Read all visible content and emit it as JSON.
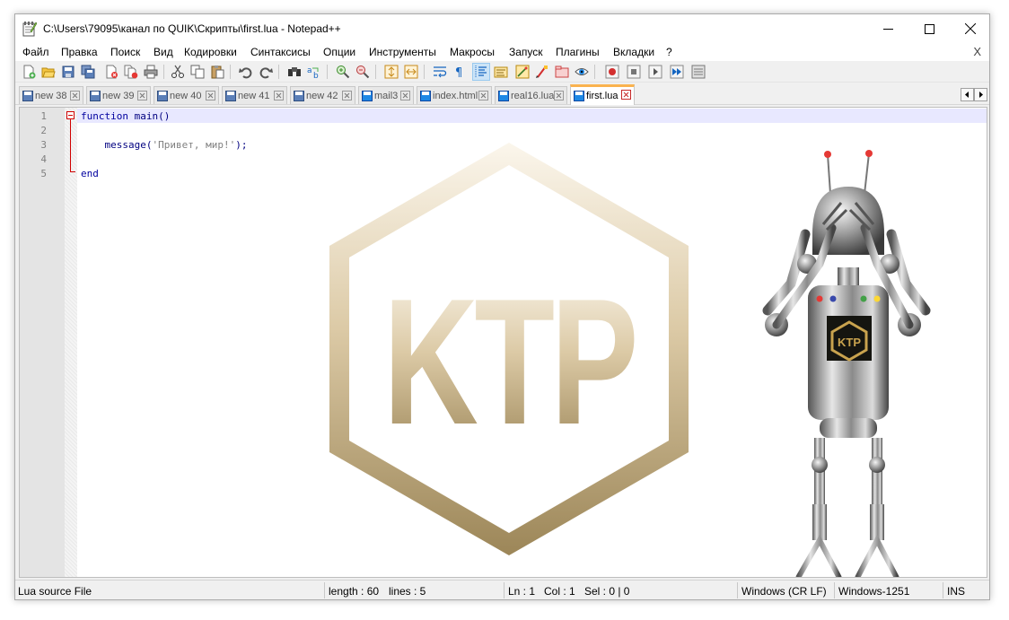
{
  "window": {
    "title": "C:\\Users\\79095\\канал по QUIK\\Скрипты\\first.lua - Notepad++"
  },
  "menu": {
    "items": [
      "Файл",
      "Правка",
      "Поиск",
      "Вид",
      "Кодировки",
      "Синтаксисы",
      "Опции",
      "Инструменты",
      "Макросы",
      "Запуск",
      "Плагины",
      "Вкладки",
      "?"
    ],
    "close_label": "X"
  },
  "tabs": [
    {
      "label": "new 38",
      "active": false
    },
    {
      "label": "new 39",
      "active": false
    },
    {
      "label": "new 40",
      "active": false
    },
    {
      "label": "new 41",
      "active": false
    },
    {
      "label": "new 42",
      "active": false
    },
    {
      "label": "mail3",
      "active": false
    },
    {
      "label": "index.html",
      "active": false
    },
    {
      "label": "real16.lua",
      "active": false
    },
    {
      "label": "first.lua",
      "active": true
    }
  ],
  "editor": {
    "line_numbers": [
      "1",
      "2",
      "3",
      "4",
      "5"
    ],
    "code": {
      "line1_kw": "function",
      "line1_rest": " main()",
      "line3_indent": "    ",
      "line3_fn": "message",
      "line3_open": "(",
      "line3_str": "'Привет, мир!'",
      "line3_close": ");",
      "line5_kw": "end"
    },
    "watermark_text": "KTP",
    "robot_badge_text": "KTP"
  },
  "statusbar": {
    "file_type": "Lua source File",
    "length": "length : 60",
    "lines": "lines : 5",
    "ln": "Ln : 1",
    "col": "Col : 1",
    "sel": "Sel : 0 | 0",
    "eol": "Windows (CR LF)",
    "encoding": "Windows-1251",
    "mode": "INS"
  },
  "colors": {
    "keyword": "#00009f",
    "string": "#808080",
    "current_line": "#e8e8ff",
    "active_tab_accent": "#fab34f",
    "fold_marker": "#d00000",
    "watermark_gold": "#9c8658"
  },
  "icons": {
    "toolbar": [
      "new-file-icon",
      "open-file-icon",
      "save-icon",
      "save-all-icon",
      "close-icon",
      "close-all-icon",
      "print-icon",
      "cut-icon",
      "copy-icon",
      "paste-icon",
      "undo-icon",
      "redo-icon",
      "find-icon",
      "replace-icon",
      "zoom-in-icon",
      "zoom-out-icon",
      "sync-vertical-icon",
      "sync-horizontal-icon",
      "word-wrap-icon",
      "show-all-chars-icon",
      "indent-guide-icon",
      "lang-define-icon",
      "doc-map-icon",
      "function-list-icon",
      "folder-workspace-icon",
      "monitoring-icon",
      "record-macro-icon",
      "stop-macro-icon",
      "play-macro-icon",
      "run-macro-multiple-icon",
      "save-macro-icon"
    ]
  }
}
